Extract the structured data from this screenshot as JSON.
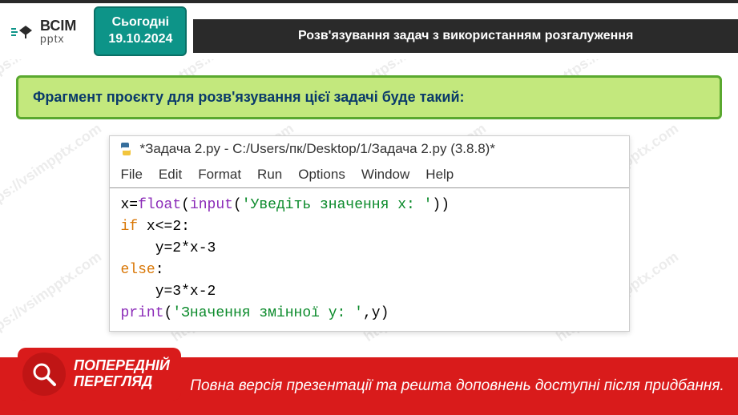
{
  "header": {
    "logo": {
      "line1": "ВСІМ",
      "line2": "pptx"
    },
    "date_badge": {
      "label": "Сьогодні",
      "date": "19.10.2024"
    },
    "title": "Розв'язування задач з використанням розгалуження"
  },
  "content": {
    "instruction": "Фрагмент проєкту для розв'язування цієї задачі буде такий:"
  },
  "editor": {
    "title": "*Задача 2.py - C:/Users/пк/Desktop/1/Задача 2.py (3.8.8)*",
    "menu": [
      "File",
      "Edit",
      "Format",
      "Run",
      "Options",
      "Window",
      "Help"
    ],
    "code": {
      "l1a": "x=",
      "l1b": "float",
      "l1c": "(",
      "l1d": "input",
      "l1e": "(",
      "l1f": "'Уведіть значення x: '",
      "l1g": "))",
      "l2a": "if",
      "l2b": " x<=2:",
      "l3": "    y=2*x-3",
      "l4a": "else",
      "l4b": ":",
      "l5": "    y=3*x-2",
      "l6a": "print",
      "l6b": "(",
      "l6c": "'Значення змінної у: '",
      "l6d": ",y)"
    }
  },
  "footer": {
    "badge": {
      "line1": "ПОПЕРЕДНІЙ",
      "line2": "ПЕРЕГЛЯД"
    },
    "notice": "Повна версія презентації та решта доповнень доступні після придбання."
  },
  "watermark_text": "https://vsimpptx.com"
}
